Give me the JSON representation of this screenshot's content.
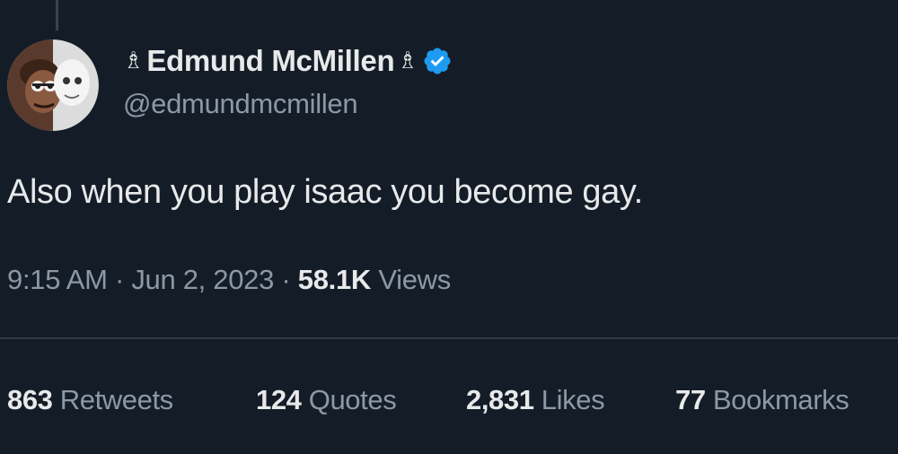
{
  "tweet": {
    "author": {
      "name_prefix_emoji": "♗",
      "display_name": "Edmund McMillen",
      "name_suffix_emoji": "♗",
      "handle": "@edmundmcmillen",
      "verified": true
    },
    "text": "Also when you play isaac you become gay.",
    "time": "9:15 AM",
    "separator": "·",
    "date": "Jun 2, 2023",
    "views_count": "58.1K",
    "views_label": "Views"
  },
  "stats": {
    "retweets": {
      "count": "863",
      "label": "Retweets"
    },
    "quotes": {
      "count": "124",
      "label": "Quotes"
    },
    "likes": {
      "count": "2,831",
      "label": "Likes"
    },
    "bookmarks": {
      "count": "77",
      "label": "Bookmarks"
    }
  },
  "colors": {
    "background": "#141d27",
    "primary_text": "#e7e9ea",
    "secondary_text": "#8b98a5",
    "verified_blue": "#1d9bf0",
    "divider": "#2f3b46"
  }
}
